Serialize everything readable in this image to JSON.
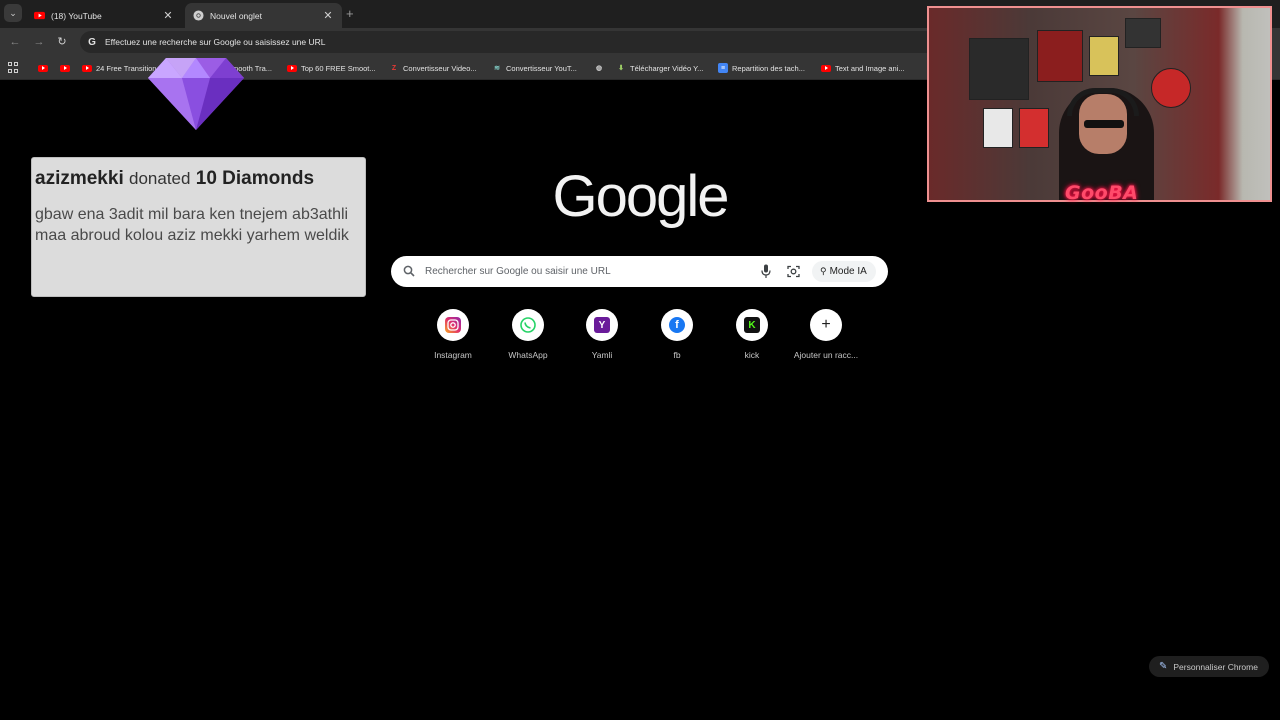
{
  "tabs": [
    {
      "title": "(18) YouTube",
      "active": false,
      "favicon": "youtube-icon"
    },
    {
      "title": "Nouvel onglet",
      "active": true,
      "favicon": "chrome-icon"
    }
  ],
  "omnibox": {
    "text": "Effectuez une recherche sur Google ou saisissez une URL"
  },
  "bookmarks": [
    {
      "label": "",
      "icon": "youtube-icon"
    },
    {
      "label": "",
      "icon": "youtube-icon"
    },
    {
      "label": "24 Free Transition",
      "icon": "youtube-icon"
    },
    {
      "label": "mooth Tra...",
      "icon": "youtube-icon"
    },
    {
      "label": "Top 60 FREE Smoot...",
      "icon": "youtube-icon"
    },
    {
      "label": "Convertisseur Video...",
      "icon": "z-icon"
    },
    {
      "label": "Convertisseur YouT...",
      "icon": "wave-icon"
    },
    {
      "label": "",
      "icon": "globe-icon"
    },
    {
      "label": "Télécharger Vidéo Y...",
      "icon": "download-icon"
    },
    {
      "label": "Repartition des tach...",
      "icon": "docs-icon"
    },
    {
      "label": "Text and Image ani...",
      "icon": "youtube-icon"
    }
  ],
  "ntp": {
    "logo": "Google",
    "search_placeholder": "Rechercher sur Google ou saisir une URL",
    "mode_ia": "Mode IA",
    "shortcuts": [
      {
        "label": "Instagram",
        "icon": "instagram-icon",
        "color": "#e1306c"
      },
      {
        "label": "WhatsApp",
        "icon": "whatsapp-icon",
        "color": "#25d366"
      },
      {
        "label": "Yamli",
        "icon": "yamli-icon",
        "color": "#6a1b9a"
      },
      {
        "label": "fb",
        "icon": "facebook-icon",
        "color": "#1877f2"
      },
      {
        "label": "kick",
        "icon": "kick-icon",
        "color": "#53fc18"
      },
      {
        "label": "Ajouter un racc...",
        "icon": "plus-icon",
        "color": "#1f1f1f"
      }
    ],
    "customize": "Personnaliser Chrome"
  },
  "alert": {
    "user": "azizmekki",
    "action": "donated",
    "amount": "10 Diamonds",
    "message": "gbaw ena 3adit mil bara ken tnejem ab3athli maa abroud kolou aziz mekki yarhem weldik"
  },
  "overlay": {
    "streamer_tag": "GooBA"
  }
}
